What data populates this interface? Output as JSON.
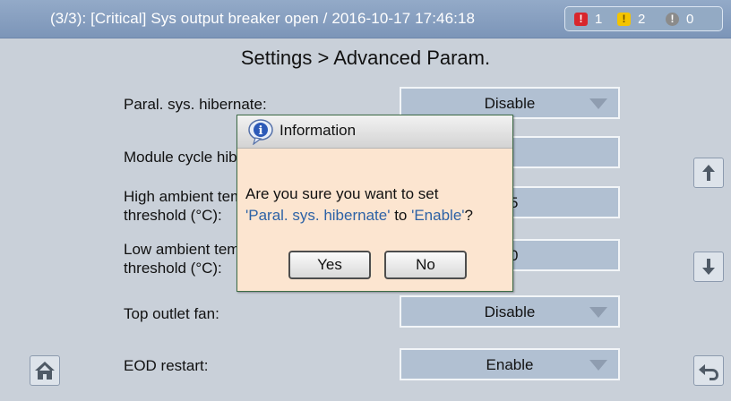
{
  "alarm_bar": {
    "message": "(3/3): [Critical] Sys output breaker open / 2016-10-17 17:46:18",
    "counts": [
      {
        "level": "critical",
        "count": "1",
        "color": "#d8262c"
      },
      {
        "level": "major",
        "count": "2",
        "color": "#f4c400"
      },
      {
        "level": "minor",
        "count": "0",
        "color": "#8b8b8b"
      }
    ]
  },
  "page": {
    "title": "Settings > Advanced Param."
  },
  "settings": [
    {
      "label": "Paral. sys. hibernate:",
      "value": "Disable"
    },
    {
      "label_1": "Module cycle hibernate period (day):",
      "value": "0"
    },
    {
      "label_1": "High ambient temp.",
      "label_2": "threshold (°C):",
      "value": "45"
    },
    {
      "label_1": "Low ambient temp.",
      "label_2": "threshold (°C):",
      "value": "10"
    },
    {
      "label": "Top outlet fan:",
      "value": "Disable"
    },
    {
      "label": "EOD restart:",
      "value": "Enable"
    }
  ],
  "nav": {
    "up_icon": "arrow-up-icon",
    "down_icon": "arrow-down-icon",
    "home_icon": "home-icon",
    "back_icon": "return-icon"
  },
  "dialog": {
    "title": "Information",
    "icon": "info-icon",
    "line1": "Are you sure you want to set",
    "param": "'Paral. sys. hibernate'",
    "connector": " to ",
    "target": "'Enable'",
    "end": "?",
    "yes_label": "Yes",
    "no_label": "No"
  }
}
